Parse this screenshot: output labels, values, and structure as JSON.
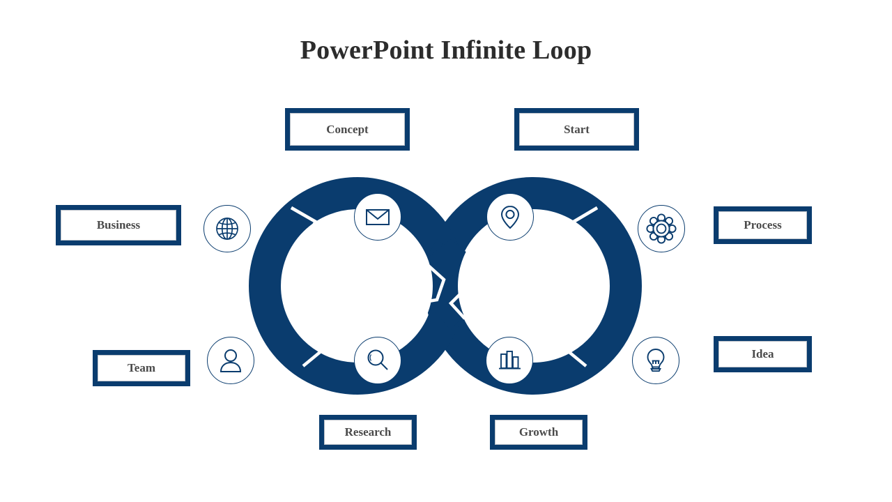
{
  "slide": {
    "title": "PowerPoint Infinite Loop",
    "background_color": "#ffffff",
    "accent_color": "#0a3c6e",
    "title_color": "#2c2c2c",
    "label_text_color": "#4a4a4a"
  },
  "labels": [
    {
      "id": "concept",
      "text": "Concept",
      "position": "top-left"
    },
    {
      "id": "start",
      "text": "Start",
      "position": "top-right"
    },
    {
      "id": "business",
      "text": "Business",
      "position": "left-upper"
    },
    {
      "id": "process",
      "text": "Process",
      "position": "right-upper"
    },
    {
      "id": "team",
      "text": "Team",
      "position": "left-lower"
    },
    {
      "id": "idea",
      "text": "Idea",
      "position": "right-lower"
    },
    {
      "id": "research",
      "text": "Research",
      "position": "bottom-left"
    },
    {
      "id": "growth",
      "text": "Growth",
      "position": "bottom-right"
    }
  ],
  "icons": [
    {
      "id": "globe",
      "name": "globe-icon",
      "linked_label": "Business"
    },
    {
      "id": "mail",
      "name": "envelope-icon",
      "linked_label": "Concept"
    },
    {
      "id": "pin",
      "name": "location-pin-icon",
      "linked_label": "Start"
    },
    {
      "id": "gear",
      "name": "gear-icon",
      "linked_label": "Process"
    },
    {
      "id": "person",
      "name": "user-icon",
      "linked_label": "Team"
    },
    {
      "id": "search",
      "name": "magnifier-icon",
      "linked_label": "Research"
    },
    {
      "id": "bars",
      "name": "bar-chart-icon",
      "linked_label": "Growth"
    },
    {
      "id": "bulb",
      "name": "lightbulb-icon",
      "linked_label": "Idea"
    }
  ],
  "diagram": {
    "shape": "infinity-loop",
    "segments_per_loop": 4,
    "band_color": "#0a3c6e",
    "separator_color": "#ffffff"
  }
}
